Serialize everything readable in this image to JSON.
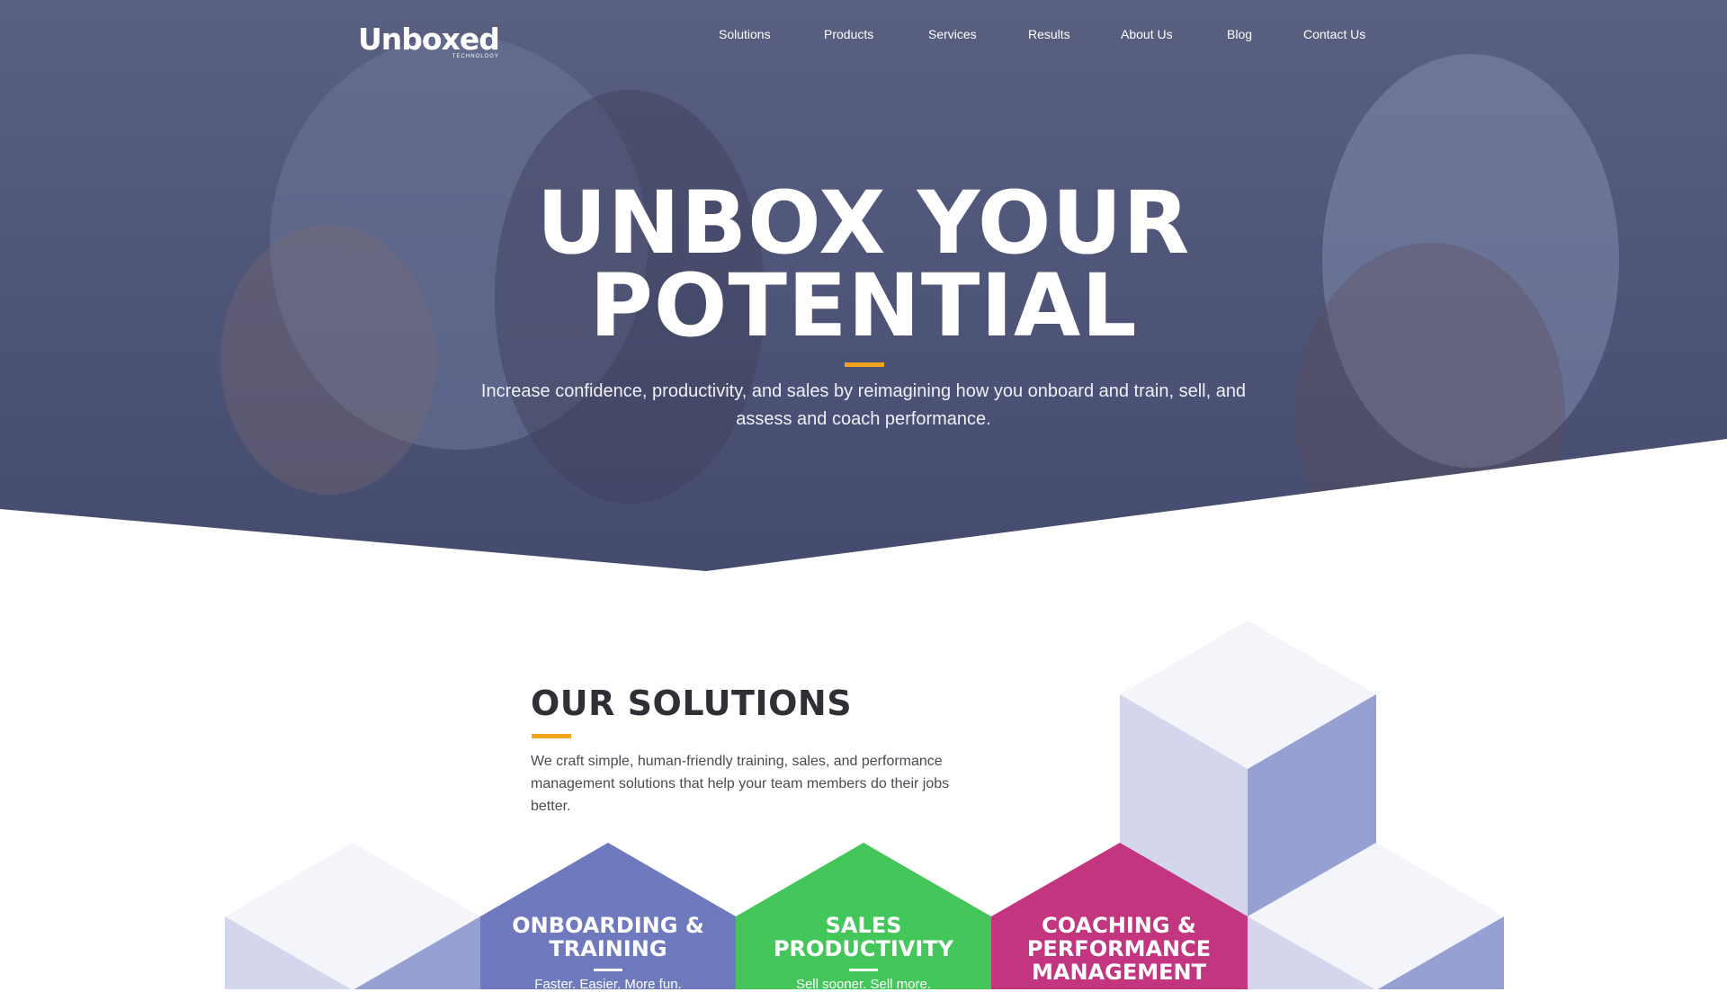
{
  "brand": {
    "name": "Unboxed",
    "tagline": "TECHNOLOGY"
  },
  "nav": {
    "items": [
      "Solutions",
      "Products",
      "Services",
      "Results",
      "About Us",
      "Blog",
      "Contact Us"
    ]
  },
  "hero": {
    "title_line1": "UNBOX YOUR",
    "title_line2": "POTENTIAL",
    "subtitle": "Increase confidence, productivity, and sales by reimagining how you onboard and train, sell, and assess and coach performance."
  },
  "solutions": {
    "title": "OUR SOLUTIONS",
    "description": "We craft simple, human-friendly training, sales, and performance management solutions that help your team members do their jobs better.",
    "cards": [
      {
        "title": "ONBOARDING & TRAINING",
        "line1": "ONBOARDING &",
        "line2": "TRAINING",
        "line3": "",
        "tagline": "Faster. Easier. More fun.",
        "color": "#6f79bd"
      },
      {
        "title": "SALES PRODUCTIVITY",
        "line1": "SALES",
        "line2": "PRODUCTIVITY",
        "line3": "",
        "tagline": "Sell sooner. Sell more.",
        "color": "#45c65a"
      },
      {
        "title": "COACHING & PERFORMANCE MANAGEMENT",
        "line1": "COACHING &",
        "line2": "PERFORMANCE",
        "line3": "MANAGEMENT",
        "tagline": "",
        "color": "#c3367f"
      }
    ]
  },
  "colors": {
    "accent": "#f5a21c",
    "hero_overlay": "#50567a",
    "cube_light": "#f4f5fb",
    "cube_mid": "#d3d6ec",
    "cube_dark": "#97a0d3"
  }
}
